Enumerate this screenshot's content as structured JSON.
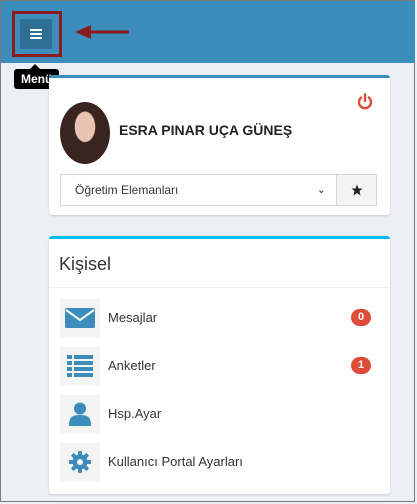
{
  "header": {
    "tooltip": "Menü"
  },
  "profile": {
    "name": "ESRA PINAR UÇA GÜNEŞ",
    "role_select": {
      "selected": "Öğretim Elemanları"
    }
  },
  "personal": {
    "title": "Kişisel",
    "items": [
      {
        "label": "Mesajlar",
        "icon": "envelope-icon",
        "badge": "0"
      },
      {
        "label": "Anketler",
        "icon": "list-icon",
        "badge": "1"
      },
      {
        "label": "Hsp.Ayar",
        "icon": "user-icon",
        "badge": null
      },
      {
        "label": "Kullanıcı Portal Ayarları",
        "icon": "gear-icon",
        "badge": null
      }
    ]
  },
  "colors": {
    "topbar": "#3c8dbc",
    "highlight_box": "#8b1a1a",
    "accent_icon": "#3c8dbc",
    "badge": "#dd4b39",
    "power": "#dd4b39"
  }
}
